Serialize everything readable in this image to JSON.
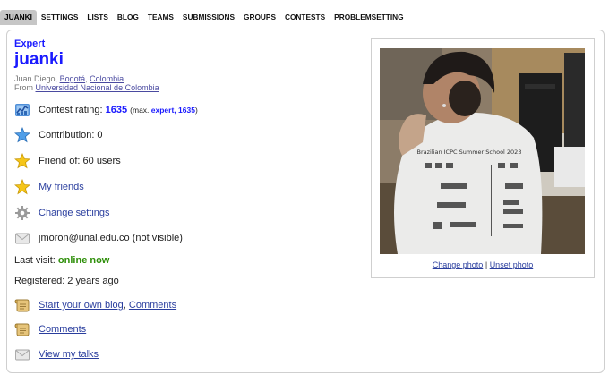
{
  "tabs": [
    "JUANKI",
    "SETTINGS",
    "LISTS",
    "BLOG",
    "TEAMS",
    "SUBMISSIONS",
    "GROUPS",
    "CONTESTS",
    "PROBLEMSETTING"
  ],
  "profile": {
    "rank": "Expert",
    "handle": "juanki",
    "name": "Juan Diego",
    "city": "Bogotá",
    "country": "Colombia",
    "from_label": "From",
    "organization": "Universidad Nacional de Colombia"
  },
  "info": {
    "rating_label": "Contest rating:",
    "rating_value": "1635",
    "rating_max_prefix": "(max.",
    "rating_max_rank": "expert, 1635",
    "rating_max_suffix": ")",
    "contribution": "Contribution: 0",
    "friend_of": "Friend of: 60 users",
    "my_friends": "My friends",
    "change_settings": "Change settings",
    "email": "jmoron@unal.edu.co (not visible)",
    "last_visit_label": "Last visit:",
    "last_visit_value": "online now",
    "registered": "Registered: 2 years ago",
    "start_blog": "Start your own blog",
    "comments_inline": "Comments",
    "comments": "Comments",
    "view_talks": "View my talks"
  },
  "photo": {
    "change_photo": "Change photo",
    "separator": "|",
    "unset_photo": "Unset photo",
    "shirt_text": "Brazilian ICPC Summer School 2023"
  },
  "colors": {
    "rank_blue": "#1a1aff",
    "online_green": "#2f8f0a",
    "link_blue": "#2a3e9e",
    "tab_active_bg": "#c6c6c6"
  }
}
